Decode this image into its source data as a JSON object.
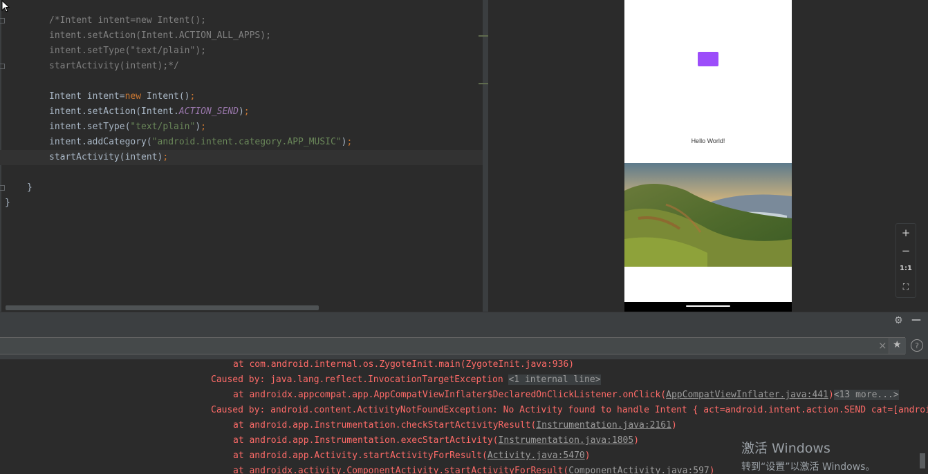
{
  "editor": {
    "lines": [
      [
        {
          "t": "/*Intent intent=new Intent();",
          "c": "cmt"
        }
      ],
      [
        {
          "t": "intent.setAction(Intent.ACTION_ALL_APPS);",
          "c": "cmt"
        }
      ],
      [
        {
          "t": "intent.setType(\"text/plain\");",
          "c": "cmt"
        }
      ],
      [
        {
          "t": "startActivity(intent);*/",
          "c": "cmt"
        }
      ],
      [],
      [
        {
          "t": "Intent intent="
        },
        {
          "t": "new",
          "c": "kw"
        },
        {
          "t": " Intent()"
        },
        {
          "t": ";",
          "c": "kw"
        }
      ],
      [
        {
          "t": "intent.setAction(Intent."
        },
        {
          "t": "ACTION_SEND",
          "c": "const"
        },
        {
          "t": ")"
        },
        {
          "t": ";",
          "c": "kw"
        }
      ],
      [
        {
          "t": "intent.setType("
        },
        {
          "t": "\"text/plain\"",
          "c": "str"
        },
        {
          "t": ")"
        },
        {
          "t": ";",
          "c": "kw"
        }
      ],
      [
        {
          "t": "intent.addCategory("
        },
        {
          "t": "\"android.intent.category.APP_MUSIC\"",
          "c": "str"
        },
        {
          "t": ")"
        },
        {
          "t": ";",
          "c": "kw"
        }
      ],
      [
        {
          "t": "startActivity(intent)"
        },
        {
          "t": ";",
          "c": "kw"
        }
      ],
      [],
      [
        {
          "t": "}"
        }
      ],
      [
        {
          "t": "}"
        }
      ]
    ]
  },
  "preview": {
    "hello_text": "Hello World!",
    "button_color": "#9c4dfa",
    "zoom": {
      "in": "+",
      "out": "−",
      "actual": "1:1",
      "fit": "⛶"
    }
  },
  "toolwindow": {
    "gear_icon": "⚙",
    "minimize_icon": "—",
    "search_clear_icon": "×",
    "star_icon": "★",
    "help_icon": "?"
  },
  "logcat": {
    "lines": [
      {
        "indent": 337,
        "parts": [
          {
            "t": "at com.android.internal.os.ZygoteInit.main(ZygoteInit.java:936)"
          }
        ]
      },
      {
        "indent": 305,
        "parts": [
          {
            "t": "Caused by: java.lang.reflect.InvocationTargetException "
          },
          {
            "t": "<1 internal line>",
            "c": "fold-text"
          }
        ]
      },
      {
        "indent": 337,
        "parts": [
          {
            "t": "at androidx.appcompat.app.AppCompatViewInflater$DeclaredOnClickListener.onClick("
          },
          {
            "t": "AppCompatViewInflater.java:441",
            "c": "link"
          },
          {
            "t": ")"
          },
          {
            "t": "<13 more...>",
            "c": "fold-text"
          }
        ]
      },
      {
        "indent": 305,
        "parts": [
          {
            "t": "Caused by: android.content.ActivityNotFoundException: No Activity found to handle Intent { act=android.intent.action.SEND cat=[android.intent.category.APP_MUSIC] typ=text/plain }"
          }
        ]
      },
      {
        "indent": 337,
        "parts": [
          {
            "t": "at android.app.Instrumentation.checkStartActivityResult("
          },
          {
            "t": "Instrumentation.java:2161",
            "c": "link"
          },
          {
            "t": ")"
          }
        ]
      },
      {
        "indent": 337,
        "parts": [
          {
            "t": "at android.app.Instrumentation.execStartActivity("
          },
          {
            "t": "Instrumentation.java:1805",
            "c": "link"
          },
          {
            "t": ")"
          }
        ]
      },
      {
        "indent": 337,
        "parts": [
          {
            "t": "at android.app.Activity.startActivityForResult("
          },
          {
            "t": "Activity.java:5470",
            "c": "link"
          },
          {
            "t": ")"
          }
        ]
      },
      {
        "indent": 337,
        "parts": [
          {
            "t": "at androidx.activity.ComponentActivity.startActivityForResult("
          },
          {
            "t": "ComponentActivity.java:597",
            "c": "link"
          },
          {
            "t": ")"
          }
        ]
      }
    ]
  },
  "watermark": {
    "title": "激活 Windows",
    "subtitle": "转到“设置”以激活 Windows。"
  }
}
